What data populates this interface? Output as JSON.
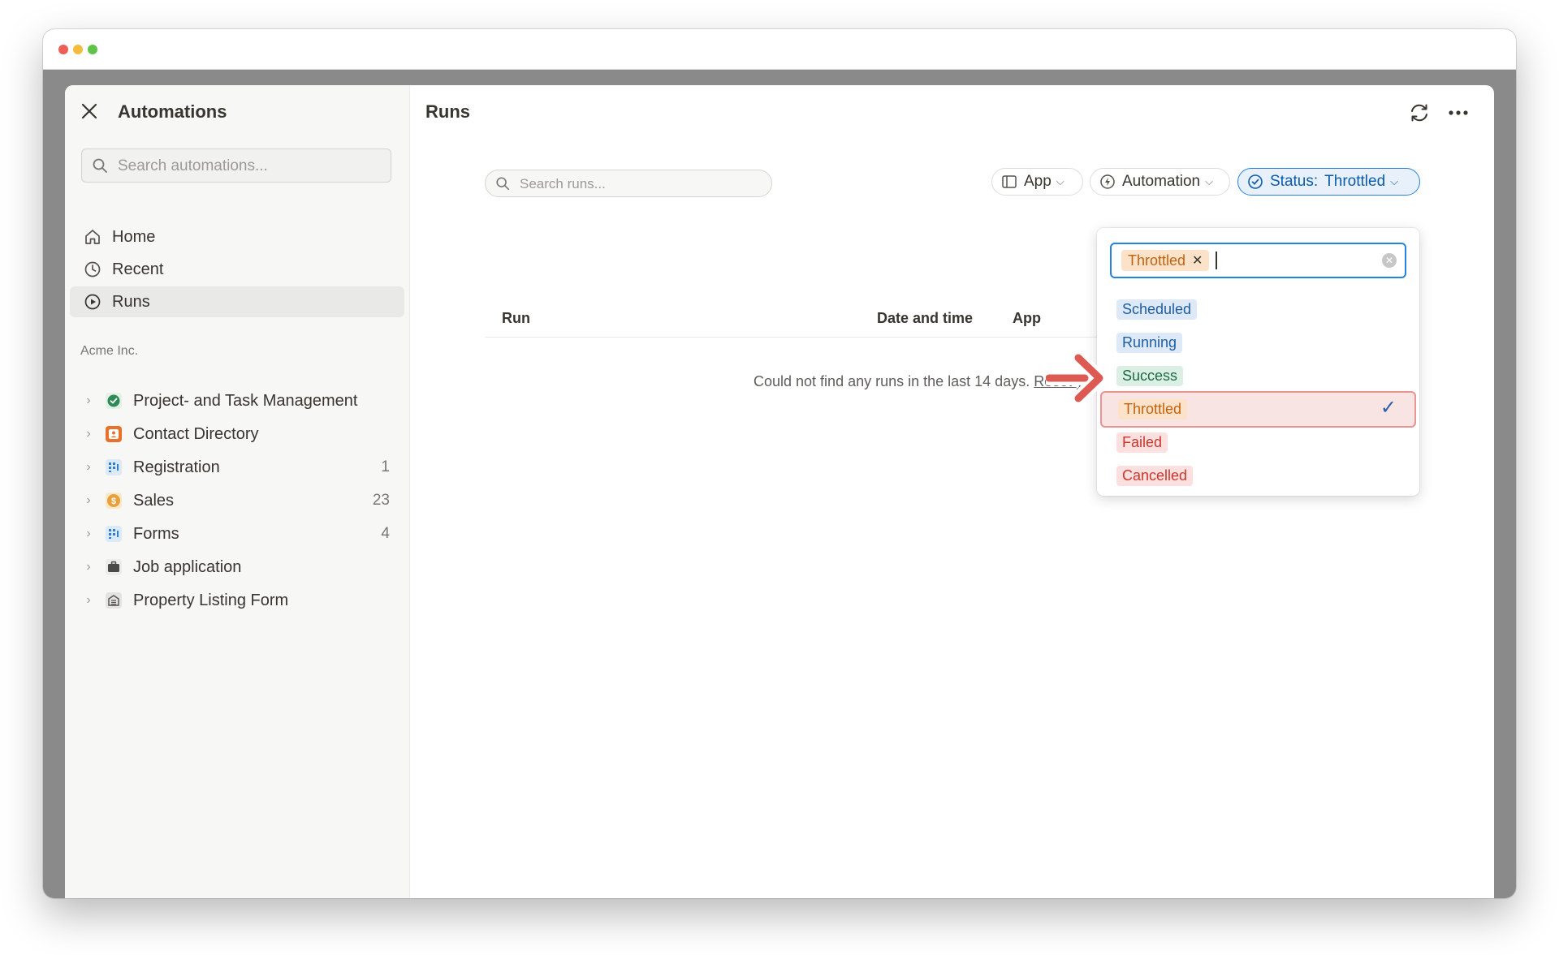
{
  "window": {
    "title": ""
  },
  "sidebar": {
    "title": "Automations",
    "search_placeholder": "Search automations...",
    "nav": [
      {
        "label": "Home",
        "icon": "home-icon"
      },
      {
        "label": "Recent",
        "icon": "clock-icon"
      },
      {
        "label": "Runs",
        "icon": "play-circle-icon",
        "active": true
      }
    ],
    "section_label": "Acme Inc.",
    "apps": [
      {
        "label": "Project- and Task Management",
        "count": "",
        "icon": "check-circle-icon",
        "color": "#2e8b57"
      },
      {
        "label": "Contact Directory",
        "count": "",
        "icon": "contact-card-icon",
        "color": "#e8712b"
      },
      {
        "label": "Registration",
        "count": "1",
        "icon": "form-grid-icon",
        "color": "#cfe2f6"
      },
      {
        "label": "Sales",
        "count": "23",
        "icon": "dollar-coin-icon",
        "color": "#e8a03a"
      },
      {
        "label": "Forms",
        "count": "4",
        "icon": "form-grid-icon",
        "color": "#cfe2f6"
      },
      {
        "label": "Job application",
        "count": "",
        "icon": "briefcase-icon",
        "color": "#4a4a4a"
      },
      {
        "label": "Property Listing Form",
        "count": "",
        "icon": "building-icon",
        "color": "#e3e3e1"
      }
    ]
  },
  "main": {
    "title": "Runs",
    "search_placeholder": "Search runs...",
    "filters": {
      "app": "App",
      "automation": "Automation",
      "status_prefix": "Status:",
      "status_value": "Throttled"
    },
    "table_headers": {
      "run": "Run",
      "date": "Date and time",
      "app": "App"
    },
    "empty_message": "Could not find any runs in the last 14 days.",
    "empty_link": "Reset you"
  },
  "status_dropdown": {
    "selected_tag": "Throttled",
    "options": [
      {
        "label": "Scheduled",
        "bg": "#dde9f7",
        "fg": "#1f5e9e"
      },
      {
        "label": "Running",
        "bg": "#dde9f7",
        "fg": "#1f5e9e"
      },
      {
        "label": "Success",
        "bg": "#dcefe4",
        "fg": "#1e6b45"
      },
      {
        "label": "Throttled",
        "bg": "#fbe2c9",
        "fg": "#c2620f",
        "selected": true
      },
      {
        "label": "Failed",
        "bg": "#fbe0df",
        "fg": "#c9372c"
      },
      {
        "label": "Cancelled",
        "bg": "#fbe0df",
        "fg": "#c9372c"
      }
    ]
  },
  "colors": {
    "accent": "#2383e2",
    "annotation_arrow": "#dd5a52"
  }
}
